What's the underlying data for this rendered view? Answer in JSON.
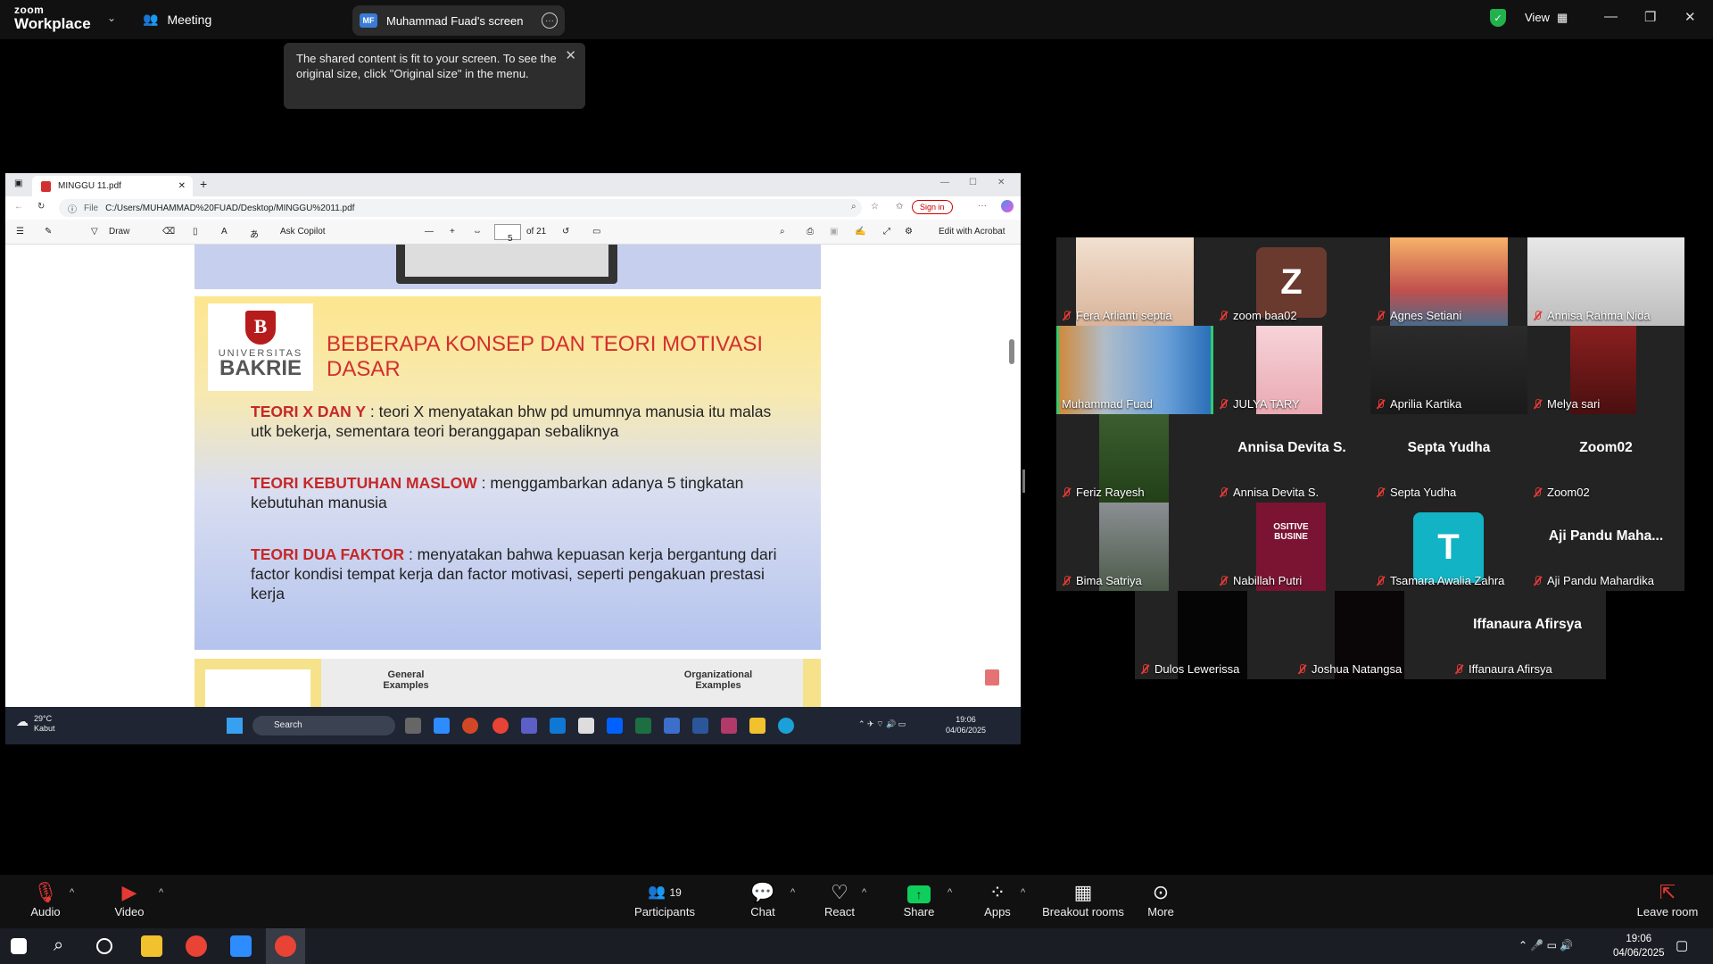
{
  "zoom": {
    "brand_top": "zoom",
    "brand_bottom": "Workplace",
    "meeting_label": "Meeting",
    "share_initials": "MF",
    "share_title": "Muhammad Fuad's screen",
    "view_label": "View"
  },
  "tooltip": {
    "text": "The shared content is fit to your screen. To see the original size, click \"Original size\" in the menu."
  },
  "browser": {
    "tab_title": "MINGGU 11.pdf",
    "file_label": "File",
    "url": "C:/Users/MUHAMMAD%20FUAD/Desktop/MINGGU%2011.pdf",
    "sign_in": "Sign in",
    "toolbar": {
      "draw": "Draw",
      "ask_copilot": "Ask Copilot",
      "page_current": "5",
      "page_total": "of 21",
      "edit_acrobat": "Edit with Acrobat"
    }
  },
  "slide": {
    "logo_uni": "UNIVERSITAS",
    "logo_name": "BAKRIE",
    "title": "BEBERAPA KONSEP DAN TEORI MOTIVASI DASAR",
    "items": [
      {
        "head": "TEORI X DAN Y",
        "body": " : teori X menyatakan bhw pd umumnya manusia itu malas utk bekerja, sementara teori beranggapan sebaliknya"
      },
      {
        "head": "TEORI KEBUTUHAN MASLOW",
        "body": " : menggambarkan adanya 5 tingkatan kebutuhan manusia"
      },
      {
        "head": "TEORI DUA FAKTOR",
        "body": " : menyatakan bahwa kepuasan kerja bergantung dari factor kondisi tempat kerja dan factor motivasi, seperti pengakuan prestasi kerja"
      }
    ],
    "next_left": "General Examples",
    "next_right": "Organizational Examples"
  },
  "remote_taskbar": {
    "weather_temp": "29°C",
    "weather_desc": "Kabut",
    "search": "Search",
    "time": "19:06",
    "date": "04/06/2025"
  },
  "participants": [
    {
      "name": "Fera Arlianti septia"
    },
    {
      "name": "zoom baa02",
      "initial": "Z"
    },
    {
      "name": "Agnes Setiani"
    },
    {
      "name": "Annisa Rahma Nida"
    },
    {
      "name": "Muhammad Fuad"
    },
    {
      "name": "JULYA TARY"
    },
    {
      "name": "Aprilia Kartika"
    },
    {
      "name": "Melya sari"
    },
    {
      "name": "Feriz Rayesh"
    },
    {
      "name": "Annisa Devita S.",
      "big": "Annisa Devita S."
    },
    {
      "name": "Septa Yudha",
      "big": "Septa Yudha"
    },
    {
      "name": "Zoom02",
      "big": "Zoom02"
    },
    {
      "name": "Bima Satriya"
    },
    {
      "name": "Nabillah Putri",
      "thumb_text": "OSITIVE BUSINE"
    },
    {
      "name": "Tsamara Awalia Zahra",
      "initial": "T"
    },
    {
      "name": "Aji Pandu Mahardika",
      "big": "Aji Pandu Maha..."
    },
    {
      "name": "Dulos Lewerissa"
    },
    {
      "name": "Joshua Natangsa"
    },
    {
      "name": "Iffanaura Afirsya",
      "big": "Iffanaura Afirsya"
    }
  ],
  "toolbar": {
    "audio": "Audio",
    "video": "Video",
    "participants_count": "19",
    "participants": "Participants",
    "chat": "Chat",
    "react": "React",
    "share": "Share",
    "apps": "Apps",
    "breakout": "Breakout rooms",
    "more": "More",
    "leave": "Leave room"
  },
  "win_taskbar": {
    "time": "19:06",
    "date": "04/06/2025"
  }
}
